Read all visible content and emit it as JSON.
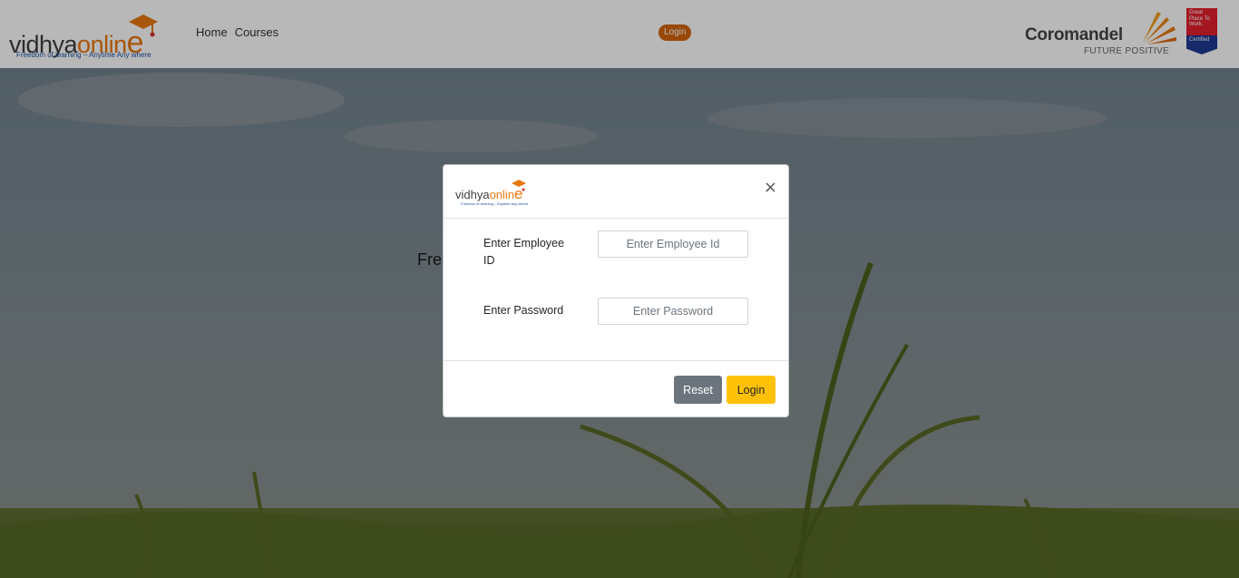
{
  "header": {
    "brand": {
      "word_prefix": "vidhya",
      "word_suffix": "onlin",
      "tagline": "Freedom of learning – Anytime Any where"
    },
    "nav": [
      {
        "label": "Home"
      },
      {
        "label": "Courses"
      }
    ],
    "login_label": "Login",
    "partner": {
      "name": "Coromandel",
      "tagline": "FUTURE POSITIVE"
    },
    "badge": {
      "top": "Great Place To Work.",
      "bottom": "Certified"
    }
  },
  "background": {
    "partial_heading": "Fre"
  },
  "modal": {
    "logo": {
      "word_prefix": "vidhya",
      "word_suffix": "onlin",
      "tagline": "Freedom of learning – Anytime Any where"
    },
    "close_glyph": "×",
    "fields": [
      {
        "label": "Enter Employee ID",
        "placeholder": "Enter Employee Id"
      },
      {
        "label": "Enter Password",
        "placeholder": "Enter Password"
      }
    ],
    "reset_label": "Reset",
    "login_label": "Login"
  },
  "colors": {
    "accent_orange": "#d4640c",
    "login_yellow": "#ffc107",
    "reset_gray": "#6c757d",
    "brand_blue": "#1a4f9e"
  }
}
